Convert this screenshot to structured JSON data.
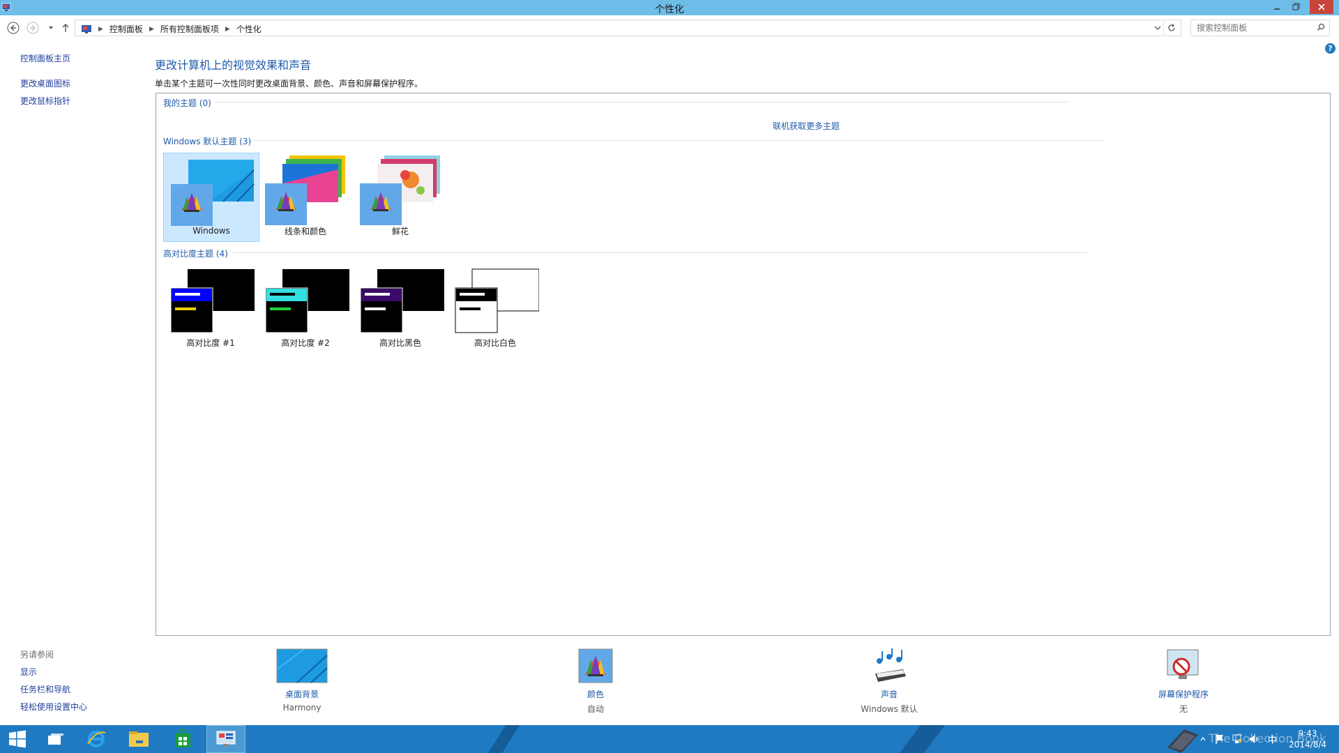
{
  "window": {
    "title": "个性化"
  },
  "address": {
    "crumbs": [
      "控制面板",
      "所有控制面板项",
      "个性化"
    ],
    "search_placeholder": "搜索控制面板"
  },
  "left_pane": {
    "links": [
      "控制面板主页",
      "更改桌面图标",
      "更改鼠标指针"
    ],
    "see_also_title": "另请参阅",
    "see_also": [
      "显示",
      "任务栏和导航",
      "轻松使用设置中心"
    ]
  },
  "main": {
    "heading": "更改计算机上的视觉效果和声音",
    "subtext": "单击某个主题可一次性同时更改桌面背景、颜色、声音和屏幕保护程序。",
    "my_themes": "我的主题 (0)",
    "get_more": "联机获取更多主题",
    "default_group": "Windows 默认主题 (3)",
    "default_themes": [
      "Windows",
      "线条和颜色",
      "鲜花"
    ],
    "hc_group": "高对比度主题 (4)",
    "hc_themes": [
      "高对比度 #1",
      "高对比度 #2",
      "高对比黑色",
      "高对比白色"
    ]
  },
  "bottom": {
    "items": [
      {
        "label": "桌面背景",
        "value": "Harmony"
      },
      {
        "label": "颜色",
        "value": "自动"
      },
      {
        "label": "声音",
        "value": "Windows 默认"
      },
      {
        "label": "屏幕保护程序",
        "value": "无"
      }
    ]
  },
  "taskbar": {
    "time": "9:43",
    "date": "2014/8/4",
    "ime": "中",
    "watermark": "The Collection Book"
  },
  "colors": {
    "titlebar": "#6ebde8",
    "taskbar": "#1f7ac1",
    "link": "#1e5aa8"
  }
}
